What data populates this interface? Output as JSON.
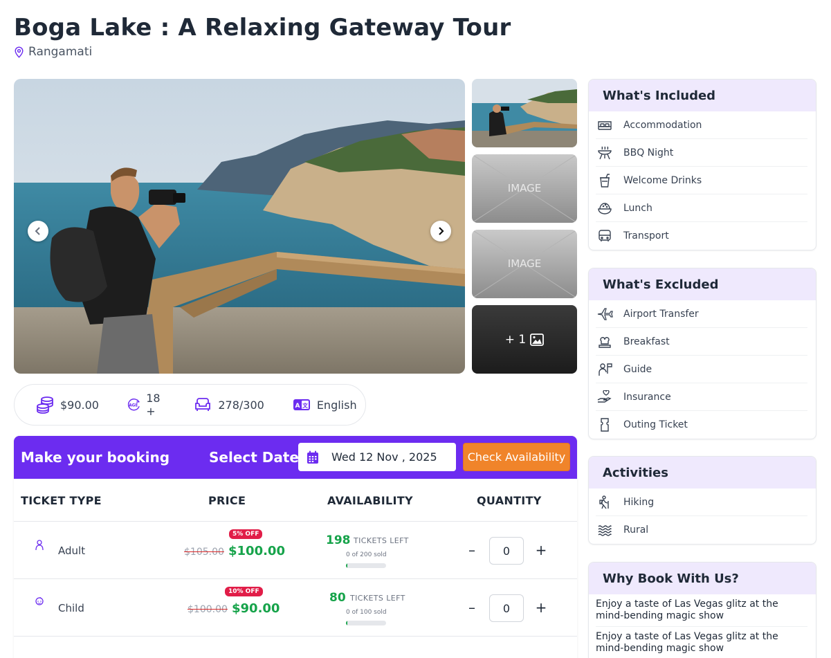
{
  "page": {
    "title": "Boga Lake : A Relaxing Gateway Tour",
    "location": "Rangamati"
  },
  "gallery": {
    "thumb_placeholder_label": "IMAGE",
    "more_count": "+ 1"
  },
  "info": {
    "price": "$90.00",
    "age": "18 +",
    "age_icon_text": "AGE",
    "seats": "278/300",
    "language": "English"
  },
  "booking": {
    "title": "Make your booking",
    "select_date_label": "Select Date :",
    "date_value": "Wed 12 Nov , 2025",
    "check_button": "Check Availability",
    "columns": [
      "TICKET TYPE",
      "PRICE",
      "AVAILABILITY",
      "QUANTITY"
    ],
    "tickets": [
      {
        "type": "Adult",
        "discount": "5% OFF",
        "old_price": "$105.00",
        "price": "$100.00",
        "left": "198",
        "left_label": "TICKETS LEFT",
        "sold_text": "0 of 200 sold",
        "sold_fraction": 0.0,
        "quantity": "0"
      },
      {
        "type": "Child",
        "discount": "10% OFF",
        "old_price": "$100.00",
        "price": "$90.00",
        "left": "80",
        "left_label": "TICKETS LEFT",
        "sold_text": "0 of 100 sold",
        "sold_fraction": 0.0,
        "quantity": "0"
      }
    ]
  },
  "included": {
    "title": "What's Included",
    "items": [
      "Accommodation",
      "BBQ Night",
      "Welcome Drinks",
      "Lunch",
      "Transport"
    ]
  },
  "excluded": {
    "title": "What's Excluded",
    "items": [
      "Airport Transfer",
      "Breakfast",
      "Guide",
      "Insurance",
      "Outing Ticket"
    ]
  },
  "activities": {
    "title": "Activities",
    "items": [
      "Hiking",
      "Rural"
    ]
  },
  "why": {
    "title": "Why Book With Us?",
    "items": [
      "Enjoy a taste of Las Vegas glitz at the mind-bending magic show",
      "Enjoy a taste of Las Vegas glitz at the mind-bending magic show"
    ]
  },
  "colors": {
    "brand": "#6c2cf0",
    "accent": "#f0842a",
    "success": "#16a34a",
    "discount": "#e11d48",
    "card_header": "#efe9fd"
  }
}
